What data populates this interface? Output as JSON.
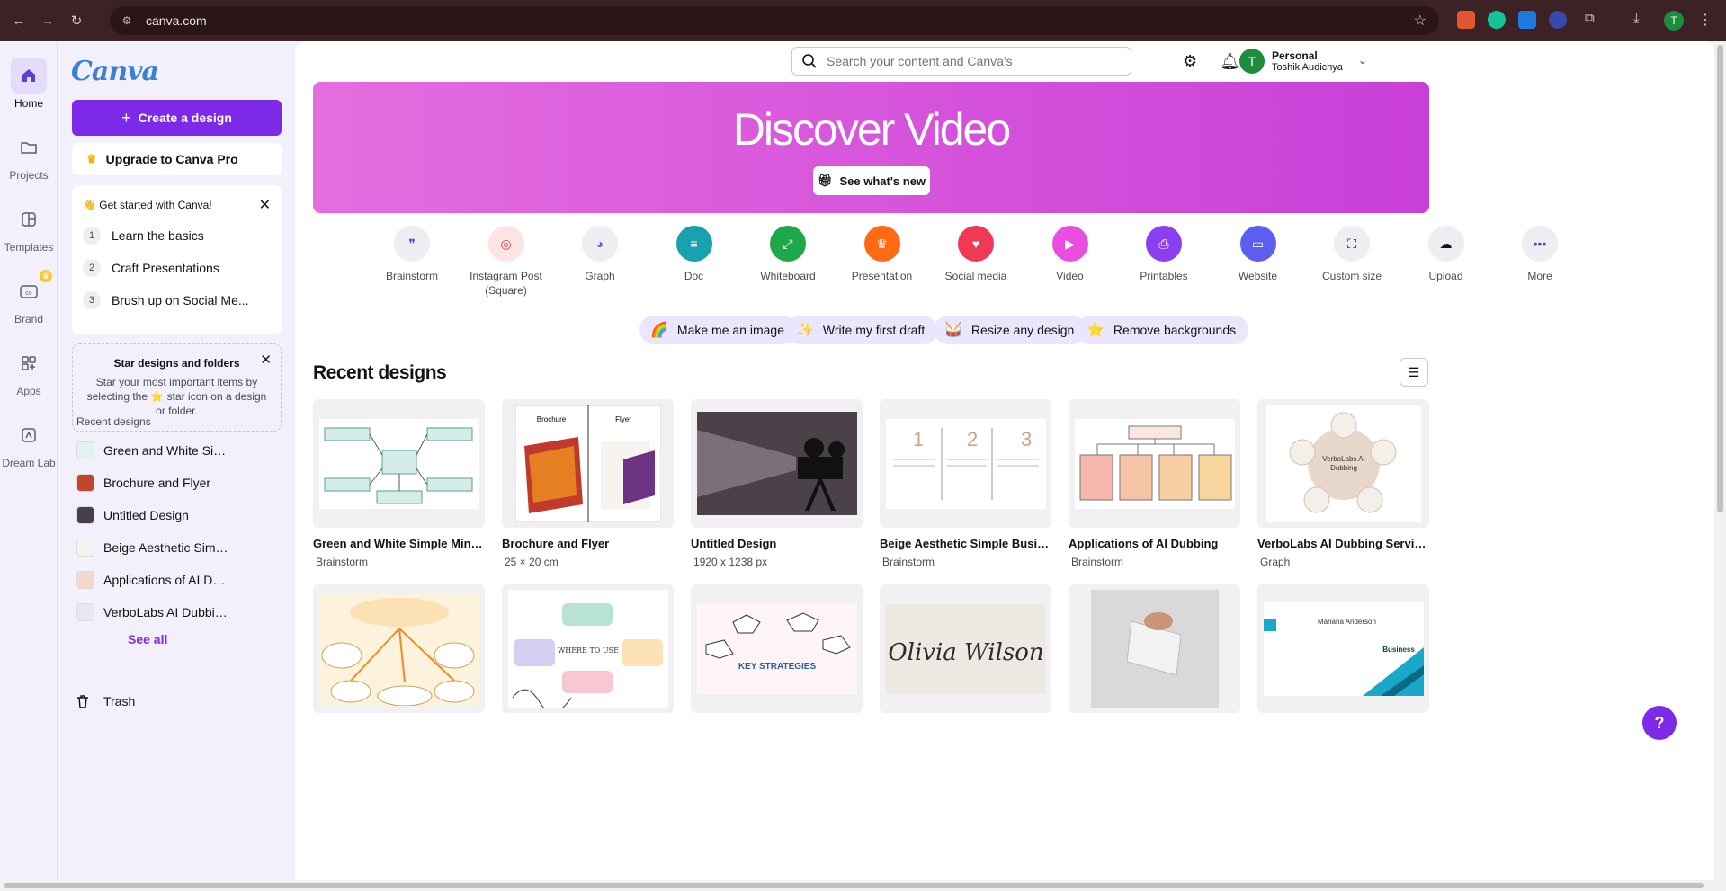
{
  "browser": {
    "url": "canva.com",
    "profile_initial": "T"
  },
  "rail": {
    "items": [
      {
        "label": "Home"
      },
      {
        "label": "Projects"
      },
      {
        "label": "Templates"
      },
      {
        "label": "Brand"
      },
      {
        "label": "Apps"
      },
      {
        "label": "Dream Lab"
      }
    ]
  },
  "panel": {
    "logo": "Canva",
    "create_label": "Create a design",
    "upgrade_label": "Upgrade to Canva Pro",
    "get_started": {
      "title": "👋 Get started with Canva!",
      "steps": [
        {
          "num": "1",
          "label": "Learn the basics"
        },
        {
          "num": "2",
          "label": "Craft Presentations"
        },
        {
          "num": "3",
          "label": "Brush up on Social Me..."
        }
      ]
    },
    "star_box": {
      "title": "Star designs and folders",
      "desc": "Star your most important items by selecting the ⭐ star icon on a design or folder."
    },
    "recent_label": "Recent designs",
    "recent_items": [
      {
        "label": "Green and White Simpl..."
      },
      {
        "label": "Brochure and Flyer"
      },
      {
        "label": "Untitled Design"
      },
      {
        "label": "Beige Aesthetic Simple ..."
      },
      {
        "label": "Applications of AI Dub..."
      },
      {
        "label": "VerboLabs AI Dubbing ..."
      }
    ],
    "see_all": "See all",
    "trash": "Trash"
  },
  "header": {
    "search_placeholder": "Search your content and Canva's",
    "account_initial": "T",
    "account_type": "Personal",
    "account_name": "Toshik Audichya"
  },
  "banner": {
    "title": "Discover Video",
    "button": "See what's new",
    "colors": {
      "start": "#e46ddf",
      "end": "#c93fd8"
    }
  },
  "design_types": [
    {
      "label": "Brainstorm",
      "color": "#eceef1",
      "fg": "#5a3ed6",
      "glyph": "❞"
    },
    {
      "label": "Instagram Post (Square)",
      "color": "#fde4e4",
      "fg": "#e4354a",
      "glyph": "◎"
    },
    {
      "label": "Graph",
      "color": "#eceef1",
      "fg": "#7d52e0",
      "glyph": "◕"
    },
    {
      "label": "Doc",
      "color": "#17a2b0",
      "fg": "#ffffff",
      "glyph": "≡"
    },
    {
      "label": "Whiteboard",
      "color": "#1ea84a",
      "fg": "#ffffff",
      "glyph": "⤢"
    },
    {
      "label": "Presentation",
      "color": "#ff6a13",
      "fg": "#ffffff",
      "glyph": "♛"
    },
    {
      "label": "Social media",
      "color": "#f03a55",
      "fg": "#ffffff",
      "glyph": "♥"
    },
    {
      "label": "Video",
      "color": "#e94ee0",
      "fg": "#ffffff",
      "glyph": "▶"
    },
    {
      "label": "Printables",
      "color": "#8b3ff0",
      "fg": "#ffffff",
      "glyph": "⎙"
    },
    {
      "label": "Website",
      "color": "#5b5ef0",
      "fg": "#ffffff",
      "glyph": "▭"
    },
    {
      "label": "Custom size",
      "color": "#eceef1",
      "fg": "#0e1318",
      "glyph": "⛶"
    },
    {
      "label": "Upload",
      "color": "#eceef1",
      "fg": "#0e1318",
      "glyph": "☁"
    },
    {
      "label": "More",
      "color": "#eceef1",
      "fg": "#5a3ed6",
      "glyph": "•••"
    }
  ],
  "chips": [
    {
      "label": "Make me an image",
      "icon": "🌈"
    },
    {
      "label": "Write my first draft",
      "icon": "✨"
    },
    {
      "label": "Resize any design",
      "icon": "🥁"
    },
    {
      "label": "Remove backgrounds",
      "icon": "⭐"
    }
  ],
  "recent": {
    "heading": "Recent designs",
    "cards": [
      {
        "title": "Green and White Simple Mind ...",
        "sub": "Brainstorm"
      },
      {
        "title": "Brochure and Flyer",
        "sub": "25 × 20 cm"
      },
      {
        "title": "Untitled Design",
        "sub": "1920 x 1238 px"
      },
      {
        "title": "Beige Aesthetic Simple Busines...",
        "sub": "Brainstorm"
      },
      {
        "title": "Applications of AI Dubbing",
        "sub": "Brainstorm"
      },
      {
        "title": "VerboLabs AI Dubbing Services",
        "sub": "Graph"
      }
    ]
  },
  "help_label": "?"
}
